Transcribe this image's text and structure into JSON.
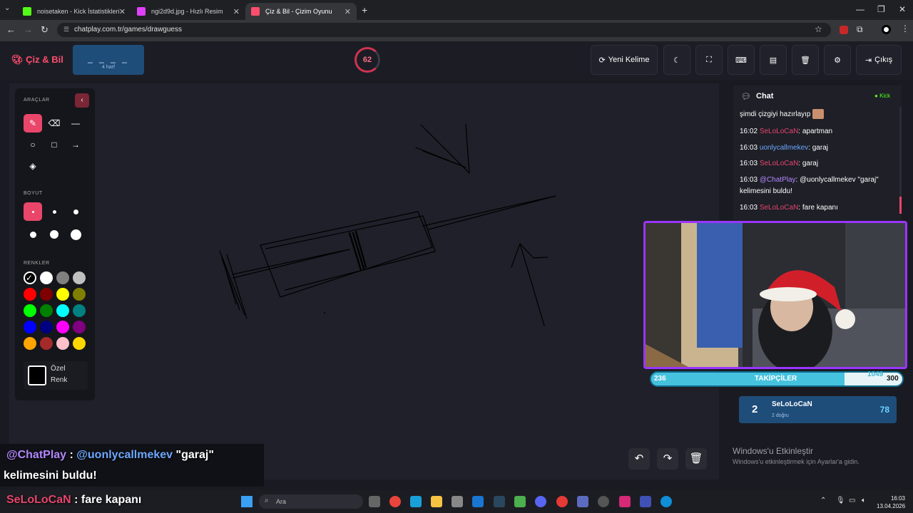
{
  "browser": {
    "tabs": [
      {
        "title": "noisetaken - Kick İstatistikleri",
        "color": "#53fc18"
      },
      {
        "title": "ngi2d9d.jpg - Hızlı Resim",
        "color": "#e040fb"
      },
      {
        "title": "Çiz & Bil - Çizim Oyunu",
        "color": "#ff4d6d"
      }
    ],
    "url": "chatplay.com.tr/games/drawguess"
  },
  "header": {
    "logo": "Çiz & Bil",
    "word_blanks": "_ _ _ _",
    "word_length": "4 harf",
    "timer": "62",
    "new_word": "Yeni Kelime",
    "exit": "Çıkış"
  },
  "tools": {
    "section_tools": "ARAÇLAR",
    "section_size": "BOYUT",
    "section_colors": "RENKLER",
    "custom_color": "Özel Renk",
    "colors": [
      "#000000",
      "#ffffff",
      "#808080",
      "#c0c0c0",
      "#ff0000",
      "#800000",
      "#ffff00",
      "#808000",
      "#00ff00",
      "#008000",
      "#00ffff",
      "#008080",
      "#0000ff",
      "#000080",
      "#ff00ff",
      "#800080",
      "#ffa500",
      "#a52a2a",
      "#ffc0cb",
      "#ffd700"
    ]
  },
  "chat": {
    "title": "Chat",
    "platform": "Kick",
    "messages": [
      {
        "time": "",
        "user": "",
        "text": "şimdi çizgiyi hazırlayıp"
      },
      {
        "time": "16:02",
        "user": "SeLoLoCaN",
        "text": ": apartman"
      },
      {
        "time": "16:03",
        "user": "uonlycallmekev",
        "text": ": garaj"
      },
      {
        "time": "16:03",
        "user": "SeLoLoCaN",
        "text": ": garaj"
      },
      {
        "time": "16:03",
        "user": "@ChatPlay",
        "text": ": @uonlycallmekev \"garaj\" kelimesini buldu!"
      },
      {
        "time": "16:03",
        "user": "SeLoLoCaN",
        "text": ": fare kapanı"
      }
    ]
  },
  "followers": {
    "label": "TAKİPÇİLER",
    "min": "236",
    "max": "300",
    "current": "1049",
    "progress": 0.77
  },
  "leaderboard": {
    "rank": "2",
    "name": "SeLoLoCaN",
    "sub": "2 doğru",
    "score": "78"
  },
  "windows": {
    "activate_title": "Windows'u Etkinleştir",
    "activate_sub": "Windows'u etkinleştirmek için Ayarlar'a gidin.",
    "search": "Ara",
    "time": "16:03",
    "date": "13.04.2026"
  },
  "overlay": {
    "line1_user": "@ChatPlay",
    "line1_sep": " : ",
    "line1_mention": "@uonlycallmekev",
    "line1_text": " \"garaj\"",
    "line2": "kelimesini buldu!",
    "line3_user": "SeLoLoCaN",
    "line3_text": " : fare kapanı"
  }
}
